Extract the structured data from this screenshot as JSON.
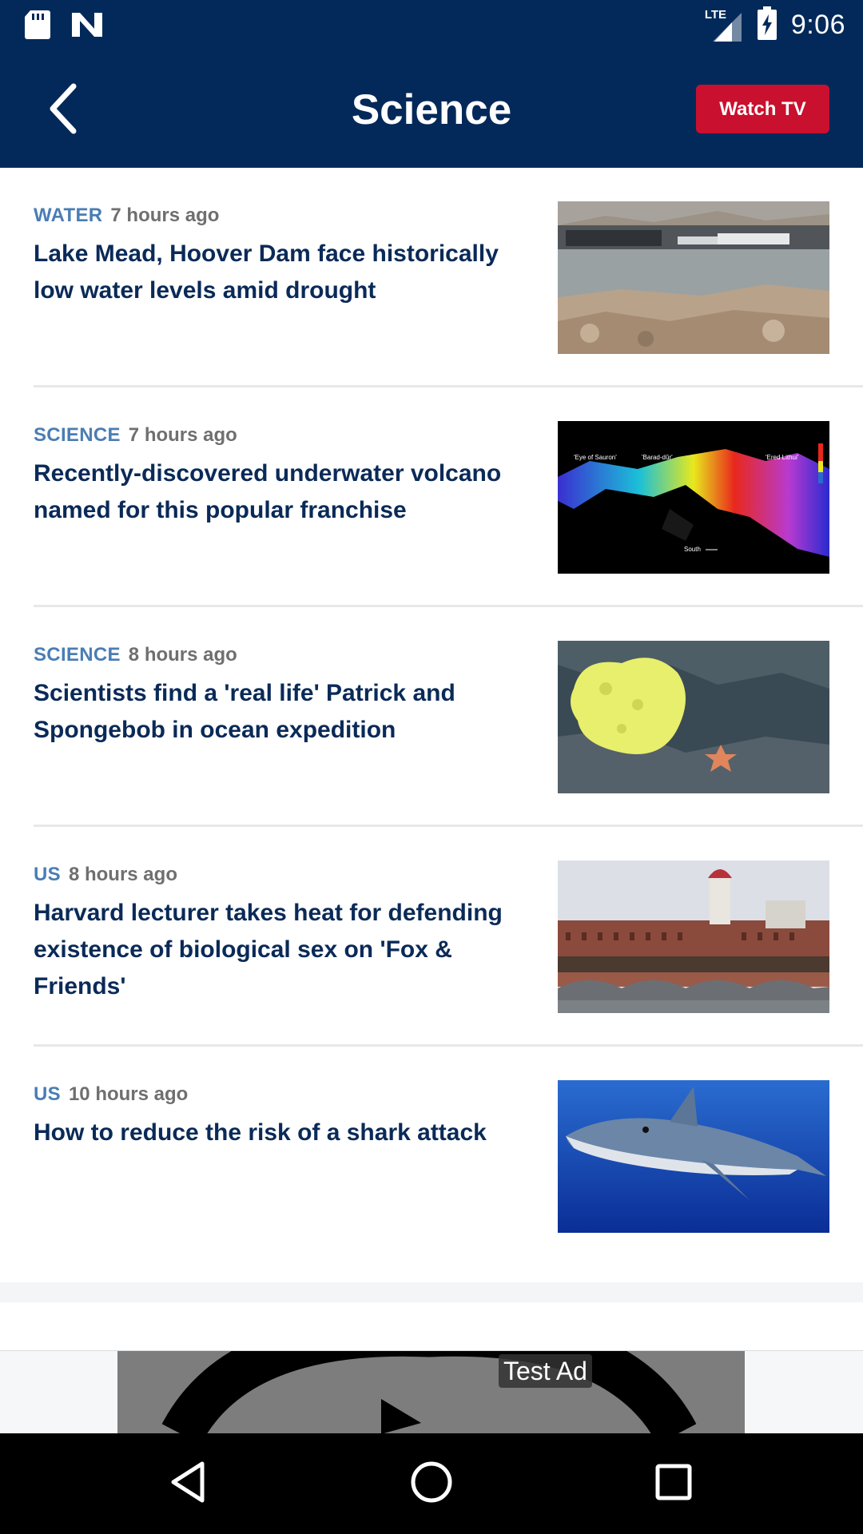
{
  "status_bar": {
    "time": "9:06",
    "network": "LTE",
    "icons": [
      "sd-card-icon",
      "app-n-icon",
      "lte-signal-icon",
      "battery-charging-icon"
    ]
  },
  "header": {
    "title": "Science",
    "back_icon": "chevron-left-icon",
    "watch_tv_label": "Watch TV"
  },
  "articles": [
    {
      "category": "WATER",
      "time": "7 hours ago",
      "headline": "Lake Mead, Hoover Dam face historically low water levels amid drought",
      "image": "lake-mead-marina"
    },
    {
      "category": "SCIENCE",
      "time": "7 hours ago",
      "headline": "Recently-discovered underwater volcano named for this popular franchise",
      "image": "volcano-bathymetry-map",
      "image_labels": [
        "'Eye of Sauron'",
        "'Barad-dûr'",
        "'Ered Lithui'",
        "South"
      ]
    },
    {
      "category": "SCIENCE",
      "time": "8 hours ago",
      "headline": "Scientists find a 'real life' Patrick and Spongebob in ocean expedition",
      "image": "sponge-and-starfish"
    },
    {
      "category": "US",
      "time": "8 hours ago",
      "headline": "Harvard lecturer takes heat for defending existence of biological sex on 'Fox & Friends'",
      "image": "harvard-campus-bridge"
    },
    {
      "category": "US",
      "time": "10 hours ago",
      "headline": "How to reduce the risk of a shark attack",
      "image": "blue-shark-underwater"
    }
  ],
  "ad": {
    "label": "Test Ad",
    "icons": [
      "adchoices-icon",
      "close-icon"
    ]
  },
  "nav_bar": {
    "icons": [
      "back-triangle-icon",
      "home-circle-icon",
      "recents-square-icon"
    ]
  },
  "colors": {
    "header_bg": "#03295a",
    "watch_tv_bg": "#c9102e",
    "category": "#4a7db4",
    "headline": "#0a2a58",
    "time": "#6f6f6f"
  }
}
